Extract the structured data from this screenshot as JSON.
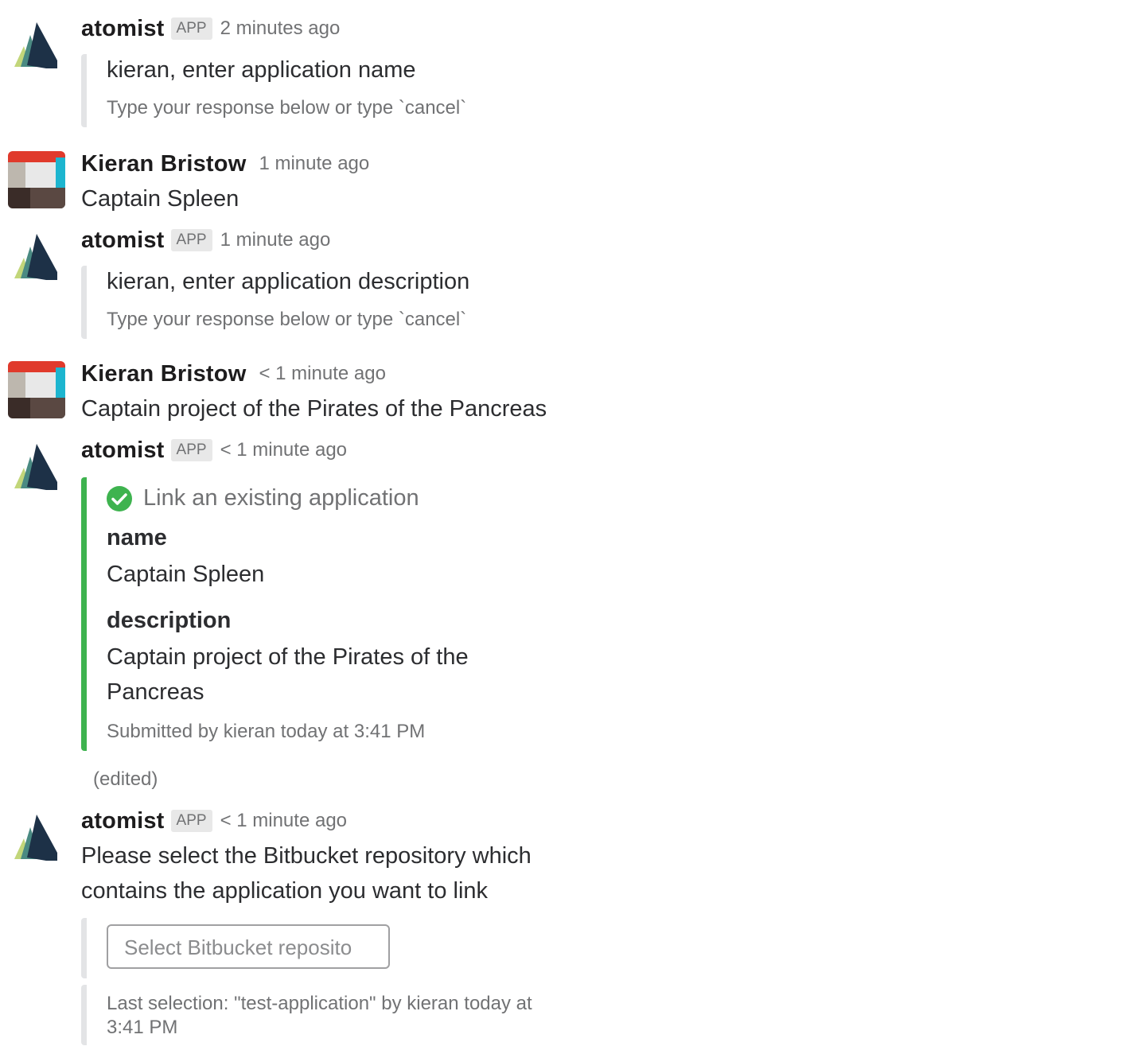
{
  "messages": [
    {
      "sender": "atomist",
      "badge": "APP",
      "time": "2 minutes ago",
      "avatar": "atomist-logo",
      "attachment": {
        "title": "kieran, enter application name",
        "hint": "Type your response below or type `cancel`"
      }
    },
    {
      "sender": "Kieran Bristow",
      "time": "1 minute ago",
      "avatar": "user-avatar",
      "text": "Captain Spleen"
    },
    {
      "sender": "atomist",
      "badge": "APP",
      "time": "1 minute ago",
      "avatar": "atomist-logo",
      "attachment": {
        "title": "kieran, enter application description",
        "hint": "Type your response below or type `cancel`"
      }
    },
    {
      "sender": "Kieran Bristow",
      "time": "< 1 minute ago",
      "avatar": "user-avatar",
      "text": "Captain project of the Pirates of the Pancreas"
    },
    {
      "sender": "atomist",
      "badge": "APP",
      "time": "< 1 minute ago",
      "avatar": "atomist-logo",
      "attachment": {
        "accent": "#3eb34f",
        "title": "Link an existing application",
        "icon": "check-circle-icon",
        "fields": [
          {
            "title": "name",
            "value": "Captain Spleen"
          },
          {
            "title": "description",
            "value_line1": "Captain project of the Pirates of the",
            "value_line2": "Pancreas"
          }
        ],
        "footer": "Submitted by kieran today at 3:41 PM"
      },
      "edited": "(edited)"
    },
    {
      "sender": "atomist",
      "badge": "APP",
      "time": "< 1 minute ago",
      "avatar": "atomist-logo",
      "text_line1": "Please select the Bitbucket repository which",
      "text_line2": "contains the application you want to link",
      "select": {
        "placeholder": "Select Bitbucket reposito"
      },
      "last_selection_line1": "Last selection: \"test-application\" by kieran today at",
      "last_selection_line2": "3:41 PM"
    }
  ],
  "colors": {
    "accent_green": "#3eb34f",
    "muted_text": "#717274",
    "attachment_border": "#e3e4e6"
  }
}
